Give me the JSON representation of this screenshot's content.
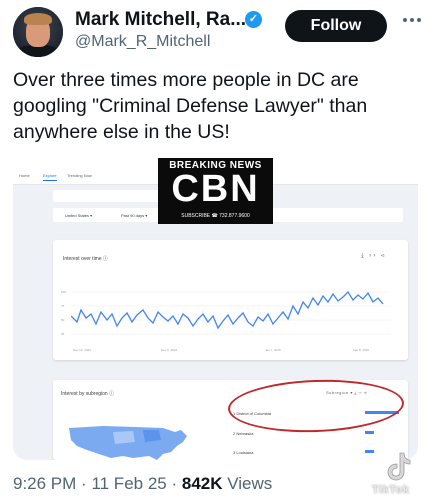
{
  "author": {
    "name": "Mark Mitchell, Ra...",
    "handle": "@Mark_R_Mitchell",
    "follow_label": "Follow"
  },
  "tweet": {
    "text": "Over three times more people in DC are googling \"Criminal Defense Lawyer\" than anywhere else in the US!",
    "time": "9:26 PM",
    "date": "11 Feb 25",
    "views_count": "842K",
    "views_label": "Views"
  },
  "trends": {
    "tabs": [
      "Home",
      "Explore",
      "Trending Now"
    ],
    "filters": [
      "United States ▾",
      "Past 90 days ▾"
    ],
    "interest_over_time": {
      "title": "Interest over time ⓘ",
      "actions": "⤓ ‹› ⋖",
      "y_ticks": [
        "100",
        "75",
        "50",
        "25"
      ],
      "x_ticks": [
        "Nov 12, 2024",
        "Dec 6, 2024",
        "Jan 7, 2025",
        "Feb 8, 2025"
      ]
    },
    "interest_by_subregion": {
      "title": "Interest by subregion ⓘ",
      "control": "Subregion ▾  ⤓ ‹› ⋖",
      "regions": [
        {
          "label": "1  District of Columbia",
          "value": 100
        },
        {
          "label": "2  Nebraska",
          "value": 27
        },
        {
          "label": "3  Louisiana",
          "value": 25
        }
      ]
    }
  },
  "logo": {
    "top": "BREAKING NEWS",
    "main": "CBN",
    "sub": "SUBSCRIBE ☎ 732.877.9600"
  },
  "watermark": "TikTok",
  "colors": {
    "follow_bg": "#0f1419",
    "verified": "#1d9bf0",
    "chart_line": "#4285f4",
    "circle": "#c0282c"
  }
}
